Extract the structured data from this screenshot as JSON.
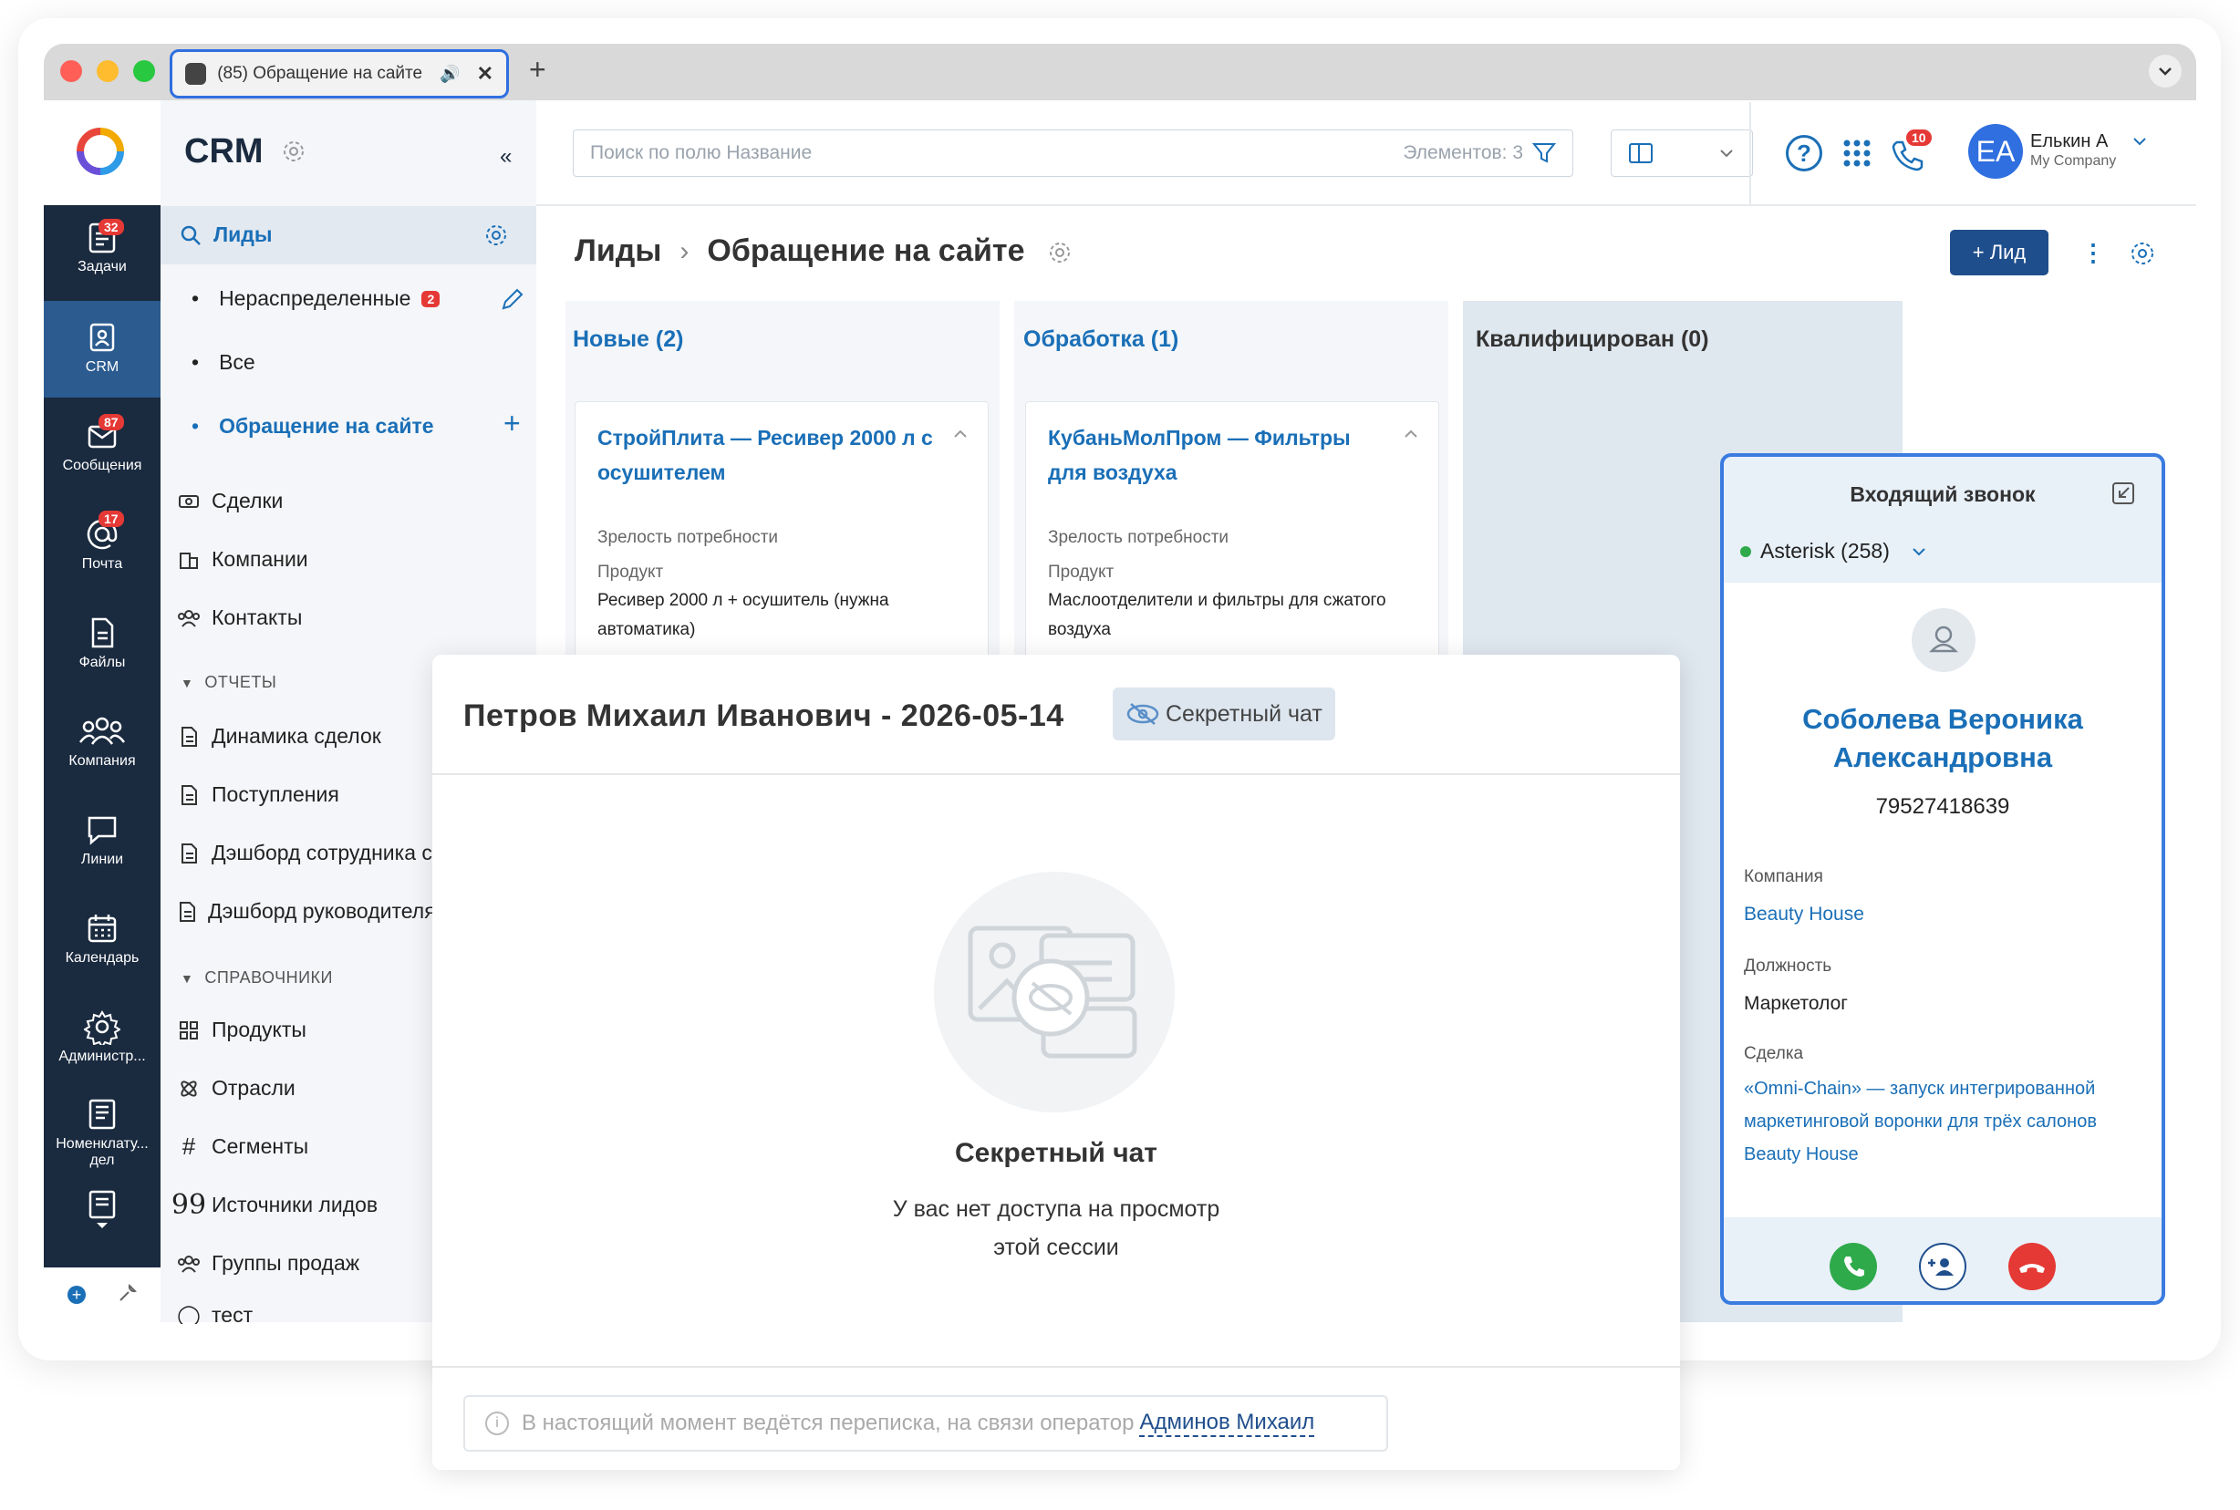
{
  "browser": {
    "tab_title": "(85) Обращение на сайте"
  },
  "app": {
    "name": "CRM"
  },
  "rail": [
    {
      "label": "Задачи",
      "badge": "32"
    },
    {
      "label": "CRM",
      "badge": ""
    },
    {
      "label": "Сообщения",
      "badge": "87"
    },
    {
      "label": "Почта",
      "badge": "17"
    },
    {
      "label": "Файлы",
      "badge": ""
    },
    {
      "label": "Компания",
      "badge": ""
    },
    {
      "label": "Линии",
      "badge": ""
    },
    {
      "label": "Календарь",
      "badge": ""
    },
    {
      "label": "Администр...",
      "badge": ""
    },
    {
      "label": "Номенклату... дел",
      "badge": ""
    }
  ],
  "sidebar": {
    "leads": "Лиды",
    "unassigned": "Нераспределенные",
    "unassigned_badge": "2",
    "all": "Все",
    "site_request": "Обращение на сайте",
    "deals": "Сделки",
    "companies": "Компании",
    "contacts": "Контакты",
    "reports_header": "ОТЧЕТЫ",
    "reports": [
      "Динамика сделок",
      "Поступления",
      "Дэшборд сотрудника с",
      "Дэшборд руководителя"
    ],
    "refs_header": "СПРАВОЧНИКИ",
    "products": "Продукты",
    "industries": "Отрасли",
    "segments": "Сегменты",
    "lead_sources": "Источники лидов",
    "sales_groups": "Группы продаж",
    "test": "тест"
  },
  "topbar": {
    "search_placeholder": "Поиск по полю Название",
    "elements_count": "Элементов: 3",
    "notif_badge": "10",
    "user_initials": "EA",
    "user_name": "Елькин А",
    "user_company": "My Company"
  },
  "page": {
    "breadcrumb_root": "Лиды",
    "breadcrumb_current": "Обращение на сайте",
    "add_lead": "+ Лид"
  },
  "kanban": {
    "columns": [
      {
        "title": "Новые (2)",
        "color": "#1a6fb7"
      },
      {
        "title": "Обработка (1)",
        "color": "#1a6fb7"
      },
      {
        "title": "Квалифицирован (0)",
        "color": "#333333"
      }
    ],
    "cards": [
      {
        "title": "СтройПлита — Ресивер 2000 л с осушителем",
        "maturity_label": "Зрелость потребности",
        "product_label": "Продукт",
        "product_value": "Ресивер 2000 л + осушитель (нужна автоматика)"
      },
      {
        "title": "КубаньМолПром — Фильтры для воздуха",
        "maturity_label": "Зрелость потребности",
        "product_label": "Продукт",
        "product_value": "Маслоотделители и фильтры для сжатого воздуха"
      }
    ]
  },
  "chat": {
    "title": "Петров Михаил Иванович - 2026-05-14",
    "secret_tag": "Секретный чат",
    "empty_title": "Секретный чат",
    "empty_line1": "У вас нет доступа на просмотр",
    "empty_line2": "этой сессии",
    "footer_text": "В настоящий момент ведётся переписка, на связи оператор",
    "footer_operator": "Админов Михаил"
  },
  "call": {
    "title": "Входящий звонок",
    "line": "Asterisk (258)",
    "caller_name_1": "Соболева Вероника",
    "caller_name_2": "Александровна",
    "phone": "79527418639",
    "company_label": "Компания",
    "company_value": "Beauty House",
    "position_label": "Должность",
    "position_value": "Маркетолог",
    "deal_label": "Сделка",
    "deal_line1": "«Omni-Chain» — запуск интегрированной",
    "deal_line2": "маркетинговой воронки для трёх салонов",
    "deal_line3": "Beauty House"
  },
  "colors": {
    "accent": "#1a6fb7",
    "rail": "#1a2a3f",
    "badge": "#e53935",
    "answer": "#2eaa4a",
    "decline": "#e53935",
    "call_border": "#3a7be0"
  }
}
